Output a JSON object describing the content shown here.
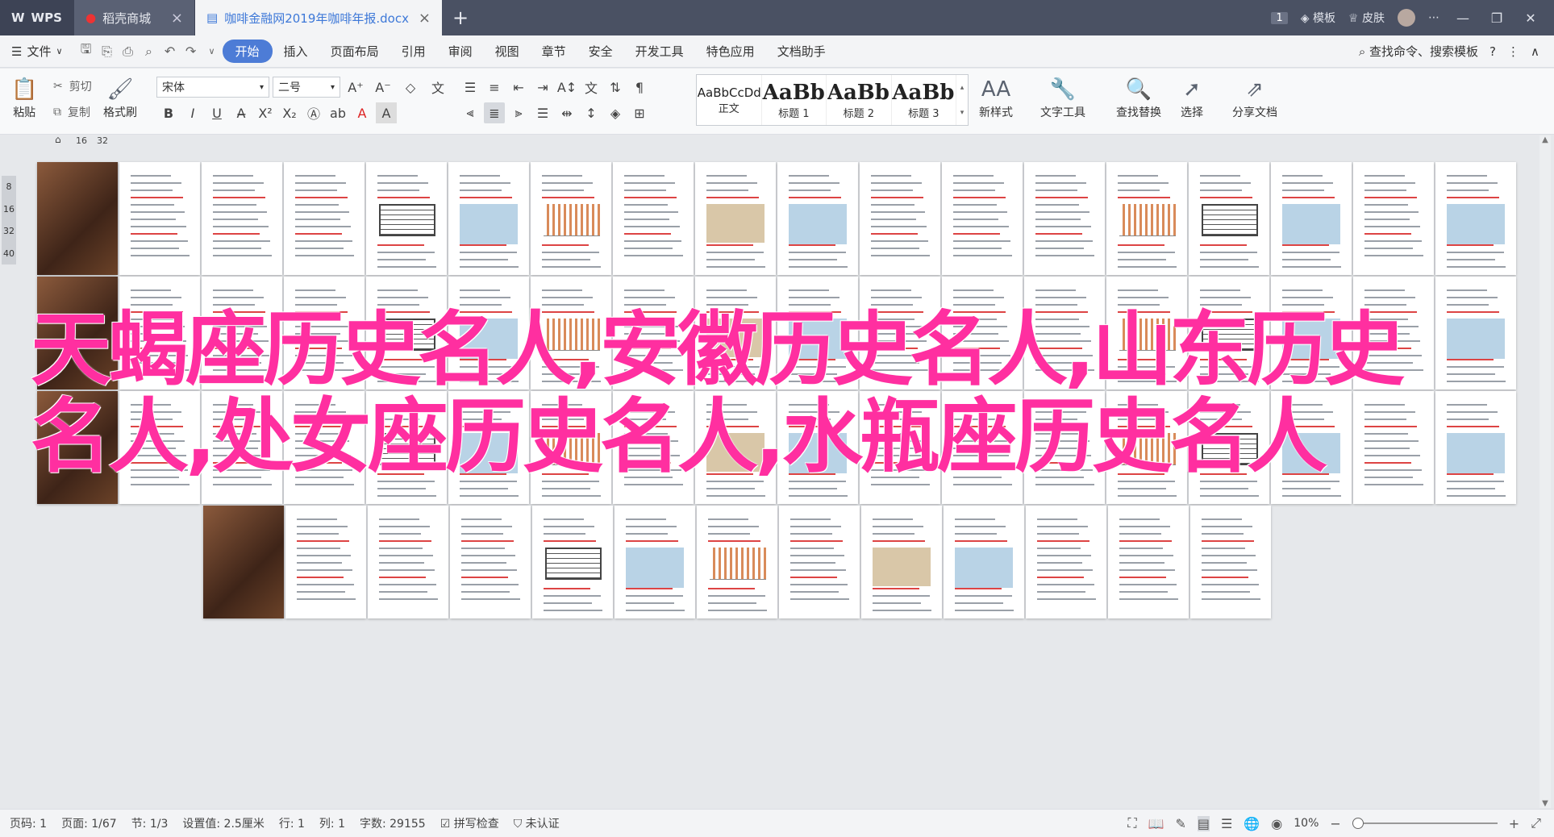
{
  "tabs": {
    "wps_label": "WPS",
    "store_label": "稻壳商城",
    "doc_label": "咖啡金融网2019年咖啡年报.docx",
    "badge": "1",
    "template_label": "模板",
    "skin_label": "皮肤"
  },
  "menu": {
    "file": "文件",
    "items": [
      "开始",
      "插入",
      "页面布局",
      "引用",
      "审阅",
      "视图",
      "章节",
      "安全",
      "开发工具",
      "特色应用",
      "文档助手"
    ],
    "search": "查找命令、搜索模板"
  },
  "ribbon": {
    "paste": "粘贴",
    "cut": "剪切",
    "copy": "复制",
    "format_painter": "格式刷",
    "font_name": "宋体",
    "font_size": "二号",
    "styles": [
      {
        "preview": "AaBbCcDd",
        "name": "正文"
      },
      {
        "preview": "AaBb",
        "name": "标题 1"
      },
      {
        "preview": "AaBb(",
        "name": "标题 2"
      },
      {
        "preview": "AaBbC",
        "name": "标题 3"
      }
    ],
    "new_style": "新样式",
    "text_tools": "文字工具",
    "find_replace": "查找替换",
    "select": "选择",
    "share": "分享文档"
  },
  "ruler": {
    "mark1": "16",
    "mark2": "32",
    "vmarks": [
      "8",
      "16",
      "32",
      "40"
    ]
  },
  "overlay_text": "天蝎座历史名人,安徽历史名人,山东历史名人,处女座历史名人,水瓶座历史名人",
  "status": {
    "page_num": "页码: 1",
    "pages": "页面: 1/67",
    "section": "节: 1/3",
    "setting": "设置值: 2.5厘米",
    "row": "行: 1",
    "col": "列: 1",
    "words": "字数: 29155",
    "spell": "拼写检查",
    "auth": "未认证",
    "zoom": "10%"
  }
}
